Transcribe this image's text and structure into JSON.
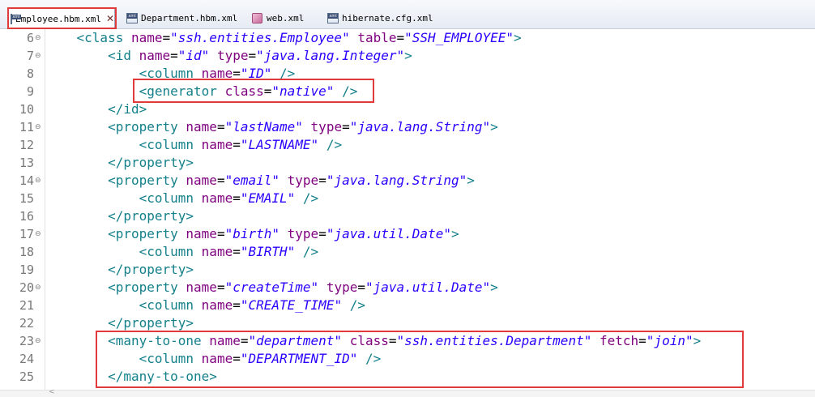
{
  "tabs": [
    {
      "label": "Employee.hbm.xml",
      "active": true,
      "icon": "xml-file-icon",
      "close": "✕"
    },
    {
      "label": "Department.hbm.xml",
      "active": false,
      "icon": "xml-file-icon"
    },
    {
      "label": "web.xml",
      "active": false,
      "icon": "web-xml-icon"
    },
    {
      "label": "hibernate.cfg.xml",
      "active": false,
      "icon": "xml-file-icon"
    }
  ],
  "colors": {
    "tag": "#14808a",
    "attribute": "#7f007f",
    "value": "#2a00ff",
    "line_number": "#787878",
    "annotation": "#e23a3a"
  },
  "editor": {
    "lines": [
      {
        "num": "6",
        "fold": true,
        "indent": "    ",
        "tokens": [
          [
            "tg",
            "<class"
          ],
          [
            "sp",
            " "
          ],
          [
            "at",
            "name"
          ],
          [
            "eq",
            "="
          ],
          [
            "vl",
            "\"ssh.entities.Employee\""
          ],
          [
            "sp",
            " "
          ],
          [
            "at",
            "table"
          ],
          [
            "eq",
            "="
          ],
          [
            "vl",
            "\"SSH_EMPLOYEE\""
          ],
          [
            "tg",
            ">"
          ]
        ]
      },
      {
        "num": "7",
        "fold": true,
        "indent": "        ",
        "tokens": [
          [
            "tg",
            "<id"
          ],
          [
            "sp",
            " "
          ],
          [
            "at",
            "name"
          ],
          [
            "eq",
            "="
          ],
          [
            "vl",
            "\"id\""
          ],
          [
            "sp",
            " "
          ],
          [
            "at",
            "type"
          ],
          [
            "eq",
            "="
          ],
          [
            "vl",
            "\"java.lang.Integer\""
          ],
          [
            "tg",
            ">"
          ]
        ]
      },
      {
        "num": "8",
        "fold": false,
        "indent": "            ",
        "tokens": [
          [
            "tg",
            "<column"
          ],
          [
            "sp",
            " "
          ],
          [
            "at",
            "name"
          ],
          [
            "eq",
            "="
          ],
          [
            "vl",
            "\"ID\""
          ],
          [
            "sp",
            " "
          ],
          [
            "tg",
            "/>"
          ]
        ]
      },
      {
        "num": "9",
        "fold": false,
        "indent": "            ",
        "tokens": [
          [
            "tg",
            "<generator"
          ],
          [
            "sp",
            " "
          ],
          [
            "at",
            "class"
          ],
          [
            "eq",
            "="
          ],
          [
            "vl",
            "\"native\""
          ],
          [
            "sp",
            " "
          ],
          [
            "tg",
            "/>"
          ]
        ]
      },
      {
        "num": "10",
        "fold": false,
        "indent": "        ",
        "tokens": [
          [
            "tg",
            "</id>"
          ]
        ]
      },
      {
        "num": "11",
        "fold": true,
        "indent": "        ",
        "tokens": [
          [
            "tg",
            "<property"
          ],
          [
            "sp",
            " "
          ],
          [
            "at",
            "name"
          ],
          [
            "eq",
            "="
          ],
          [
            "vl",
            "\"lastName\""
          ],
          [
            "sp",
            " "
          ],
          [
            "at",
            "type"
          ],
          [
            "eq",
            "="
          ],
          [
            "vl",
            "\"java.lang.String\""
          ],
          [
            "tg",
            ">"
          ]
        ]
      },
      {
        "num": "12",
        "fold": false,
        "indent": "            ",
        "tokens": [
          [
            "tg",
            "<column"
          ],
          [
            "sp",
            " "
          ],
          [
            "at",
            "name"
          ],
          [
            "eq",
            "="
          ],
          [
            "vl",
            "\"LASTNAME\""
          ],
          [
            "sp",
            " "
          ],
          [
            "tg",
            "/>"
          ]
        ]
      },
      {
        "num": "13",
        "fold": false,
        "indent": "        ",
        "tokens": [
          [
            "tg",
            "</property>"
          ]
        ]
      },
      {
        "num": "14",
        "fold": true,
        "indent": "        ",
        "tokens": [
          [
            "tg",
            "<property"
          ],
          [
            "sp",
            " "
          ],
          [
            "at",
            "name"
          ],
          [
            "eq",
            "="
          ],
          [
            "vl",
            "\"email\""
          ],
          [
            "sp",
            " "
          ],
          [
            "at",
            "type"
          ],
          [
            "eq",
            "="
          ],
          [
            "vl",
            "\"java.lang.String\""
          ],
          [
            "tg",
            ">"
          ]
        ]
      },
      {
        "num": "15",
        "fold": false,
        "indent": "            ",
        "tokens": [
          [
            "tg",
            "<column"
          ],
          [
            "sp",
            " "
          ],
          [
            "at",
            "name"
          ],
          [
            "eq",
            "="
          ],
          [
            "vl",
            "\"EMAIL\""
          ],
          [
            "sp",
            " "
          ],
          [
            "tg",
            "/>"
          ]
        ]
      },
      {
        "num": "16",
        "fold": false,
        "indent": "        ",
        "tokens": [
          [
            "tg",
            "</property>"
          ]
        ]
      },
      {
        "num": "17",
        "fold": true,
        "indent": "        ",
        "tokens": [
          [
            "tg",
            "<property"
          ],
          [
            "sp",
            " "
          ],
          [
            "at",
            "name"
          ],
          [
            "eq",
            "="
          ],
          [
            "vl",
            "\"birth\""
          ],
          [
            "sp",
            " "
          ],
          [
            "at",
            "type"
          ],
          [
            "eq",
            "="
          ],
          [
            "vl",
            "\"java.util.Date\""
          ],
          [
            "tg",
            ">"
          ]
        ]
      },
      {
        "num": "18",
        "fold": false,
        "indent": "            ",
        "tokens": [
          [
            "tg",
            "<column"
          ],
          [
            "sp",
            " "
          ],
          [
            "at",
            "name"
          ],
          [
            "eq",
            "="
          ],
          [
            "vl",
            "\"BIRTH\""
          ],
          [
            "sp",
            " "
          ],
          [
            "tg",
            "/>"
          ]
        ]
      },
      {
        "num": "19",
        "fold": false,
        "indent": "        ",
        "tokens": [
          [
            "tg",
            "</property>"
          ]
        ]
      },
      {
        "num": "20",
        "fold": true,
        "indent": "        ",
        "tokens": [
          [
            "tg",
            "<property"
          ],
          [
            "sp",
            " "
          ],
          [
            "at",
            "name"
          ],
          [
            "eq",
            "="
          ],
          [
            "vl",
            "\"createTime\""
          ],
          [
            "sp",
            " "
          ],
          [
            "at",
            "type"
          ],
          [
            "eq",
            "="
          ],
          [
            "vl",
            "\"java.util.Date\""
          ],
          [
            "tg",
            ">"
          ]
        ]
      },
      {
        "num": "21",
        "fold": false,
        "indent": "            ",
        "tokens": [
          [
            "tg",
            "<column"
          ],
          [
            "sp",
            " "
          ],
          [
            "at",
            "name"
          ],
          [
            "eq",
            "="
          ],
          [
            "vl",
            "\"CREATE_TIME\""
          ],
          [
            "sp",
            " "
          ],
          [
            "tg",
            "/>"
          ]
        ]
      },
      {
        "num": "22",
        "fold": false,
        "indent": "        ",
        "tokens": [
          [
            "tg",
            "</property>"
          ]
        ]
      },
      {
        "num": "23",
        "fold": true,
        "indent": "        ",
        "tokens": [
          [
            "tg",
            "<many-to-one"
          ],
          [
            "sp",
            " "
          ],
          [
            "at",
            "name"
          ],
          [
            "eq",
            "="
          ],
          [
            "vl",
            "\"department\""
          ],
          [
            "sp",
            " "
          ],
          [
            "at",
            "class"
          ],
          [
            "eq",
            "="
          ],
          [
            "vl",
            "\"ssh.entities.Department\""
          ],
          [
            "sp",
            " "
          ],
          [
            "at",
            "fetch"
          ],
          [
            "eq",
            "="
          ],
          [
            "vl",
            "\"join\""
          ],
          [
            "tg",
            ">"
          ]
        ]
      },
      {
        "num": "24",
        "fold": false,
        "indent": "            ",
        "tokens": [
          [
            "tg",
            "<column"
          ],
          [
            "sp",
            " "
          ],
          [
            "at",
            "name"
          ],
          [
            "eq",
            "="
          ],
          [
            "vl",
            "\"DEPARTMENT_ID\""
          ],
          [
            "sp",
            " "
          ],
          [
            "tg",
            "/>"
          ]
        ]
      },
      {
        "num": "25",
        "fold": false,
        "indent": "        ",
        "tokens": [
          [
            "tg",
            "</many-to-one>"
          ]
        ]
      }
    ]
  }
}
